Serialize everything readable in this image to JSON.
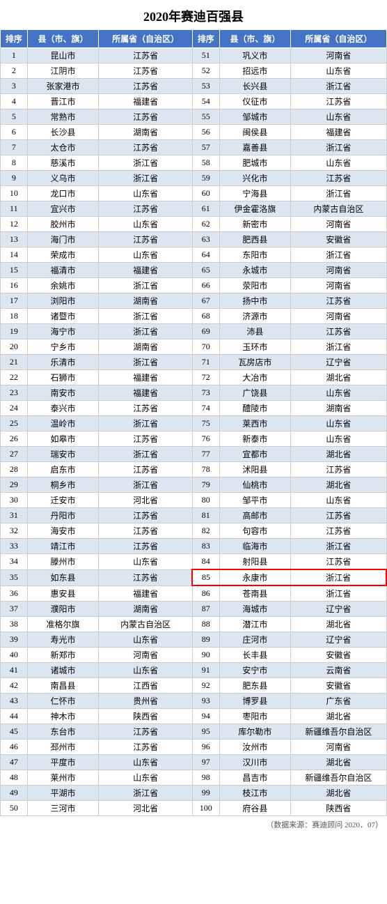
{
  "title": "2020年赛迪百强县",
  "footer": "（数据来源：赛迪顾问  2020．07）",
  "headers": [
    "排序",
    "县（市、旗）",
    "所属省（自治区）",
    "排序",
    "县（市、旗）",
    "所属省（自治区）"
  ],
  "rows": [
    {
      "left": {
        "rank": "1",
        "county": "昆山市",
        "province": "江苏省"
      },
      "right": {
        "rank": "51",
        "county": "巩义市",
        "province": "河南省"
      }
    },
    {
      "left": {
        "rank": "2",
        "county": "江阴市",
        "province": "江苏省"
      },
      "right": {
        "rank": "52",
        "county": "招远市",
        "province": "山东省"
      }
    },
    {
      "left": {
        "rank": "3",
        "county": "张家港市",
        "province": "江苏省"
      },
      "right": {
        "rank": "53",
        "county": "长兴县",
        "province": "浙江省"
      }
    },
    {
      "left": {
        "rank": "4",
        "county": "晋江市",
        "province": "福建省"
      },
      "right": {
        "rank": "54",
        "county": "仪征市",
        "province": "江苏省"
      }
    },
    {
      "left": {
        "rank": "5",
        "county": "常熟市",
        "province": "江苏省"
      },
      "right": {
        "rank": "55",
        "county": "邹城市",
        "province": "山东省"
      }
    },
    {
      "left": {
        "rank": "6",
        "county": "长沙县",
        "province": "湖南省"
      },
      "right": {
        "rank": "56",
        "county": "闽侯县",
        "province": "福建省"
      }
    },
    {
      "left": {
        "rank": "7",
        "county": "太仓市",
        "province": "江苏省"
      },
      "right": {
        "rank": "57",
        "county": "嘉善县",
        "province": "浙江省"
      }
    },
    {
      "left": {
        "rank": "8",
        "county": "慈溪市",
        "province": "浙江省"
      },
      "right": {
        "rank": "58",
        "county": "肥城市",
        "province": "山东省"
      }
    },
    {
      "left": {
        "rank": "9",
        "county": "义乌市",
        "province": "浙江省"
      },
      "right": {
        "rank": "59",
        "county": "兴化市",
        "province": "江苏省"
      }
    },
    {
      "left": {
        "rank": "10",
        "county": "龙口市",
        "province": "山东省"
      },
      "right": {
        "rank": "60",
        "county": "宁海县",
        "province": "浙江省"
      }
    },
    {
      "left": {
        "rank": "11",
        "county": "宜兴市",
        "province": "江苏省"
      },
      "right": {
        "rank": "61",
        "county": "伊金霍洛旗",
        "province": "内蒙古自治区"
      }
    },
    {
      "left": {
        "rank": "12",
        "county": "胶州市",
        "province": "山东省"
      },
      "right": {
        "rank": "62",
        "county": "新密市",
        "province": "河南省"
      }
    },
    {
      "left": {
        "rank": "13",
        "county": "海门市",
        "province": "江苏省"
      },
      "right": {
        "rank": "63",
        "county": "肥西县",
        "province": "安徽省"
      }
    },
    {
      "left": {
        "rank": "14",
        "county": "荣成市",
        "province": "山东省"
      },
      "right": {
        "rank": "64",
        "county": "东阳市",
        "province": "浙江省"
      }
    },
    {
      "left": {
        "rank": "15",
        "county": "福清市",
        "province": "福建省"
      },
      "right": {
        "rank": "65",
        "county": "永城市",
        "province": "河南省"
      }
    },
    {
      "left": {
        "rank": "16",
        "county": "余姚市",
        "province": "浙江省"
      },
      "right": {
        "rank": "66",
        "county": "荥阳市",
        "province": "河南省"
      }
    },
    {
      "left": {
        "rank": "17",
        "county": "浏阳市",
        "province": "湖南省"
      },
      "right": {
        "rank": "67",
        "county": "扬中市",
        "province": "江苏省"
      }
    },
    {
      "left": {
        "rank": "18",
        "county": "诸暨市",
        "province": "浙江省"
      },
      "right": {
        "rank": "68",
        "county": "济源市",
        "province": "河南省"
      }
    },
    {
      "left": {
        "rank": "19",
        "county": "海宁市",
        "province": "浙江省"
      },
      "right": {
        "rank": "69",
        "county": "沛县",
        "province": "江苏省"
      }
    },
    {
      "left": {
        "rank": "20",
        "county": "宁乡市",
        "province": "湖南省"
      },
      "right": {
        "rank": "70",
        "county": "玉环市",
        "province": "浙江省"
      }
    },
    {
      "left": {
        "rank": "21",
        "county": "乐清市",
        "province": "浙江省"
      },
      "right": {
        "rank": "71",
        "county": "瓦房店市",
        "province": "辽宁省"
      }
    },
    {
      "left": {
        "rank": "22",
        "county": "石狮市",
        "province": "福建省"
      },
      "right": {
        "rank": "72",
        "county": "大冶市",
        "province": "湖北省"
      }
    },
    {
      "left": {
        "rank": "23",
        "county": "南安市",
        "province": "福建省"
      },
      "right": {
        "rank": "73",
        "county": "广饶县",
        "province": "山东省"
      }
    },
    {
      "left": {
        "rank": "24",
        "county": "泰兴市",
        "province": "江苏省"
      },
      "right": {
        "rank": "74",
        "county": "醴陵市",
        "province": "湖南省"
      }
    },
    {
      "left": {
        "rank": "25",
        "county": "温岭市",
        "province": "浙江省"
      },
      "right": {
        "rank": "75",
        "county": "莱西市",
        "province": "山东省"
      }
    },
    {
      "left": {
        "rank": "26",
        "county": "如皋市",
        "province": "江苏省"
      },
      "right": {
        "rank": "76",
        "county": "新泰市",
        "province": "山东省"
      }
    },
    {
      "left": {
        "rank": "27",
        "county": "瑞安市",
        "province": "浙江省"
      },
      "right": {
        "rank": "77",
        "county": "宜都市",
        "province": "湖北省"
      }
    },
    {
      "left": {
        "rank": "28",
        "county": "启东市",
        "province": "江苏省"
      },
      "right": {
        "rank": "78",
        "county": "沭阳县",
        "province": "江苏省"
      }
    },
    {
      "left": {
        "rank": "29",
        "county": "桐乡市",
        "province": "浙江省"
      },
      "right": {
        "rank": "79",
        "county": "仙桃市",
        "province": "湖北省"
      }
    },
    {
      "left": {
        "rank": "30",
        "county": "迁安市",
        "province": "河北省"
      },
      "right": {
        "rank": "80",
        "county": "邹平市",
        "province": "山东省"
      }
    },
    {
      "left": {
        "rank": "31",
        "county": "丹阳市",
        "province": "江苏省"
      },
      "right": {
        "rank": "81",
        "county": "高邮市",
        "province": "江苏省"
      }
    },
    {
      "left": {
        "rank": "32",
        "county": "海安市",
        "province": "江苏省"
      },
      "right": {
        "rank": "82",
        "county": "句容市",
        "province": "江苏省"
      }
    },
    {
      "left": {
        "rank": "33",
        "county": "靖江市",
        "province": "江苏省"
      },
      "right": {
        "rank": "83",
        "county": "临海市",
        "province": "浙江省"
      }
    },
    {
      "left": {
        "rank": "34",
        "county": "滕州市",
        "province": "山东省"
      },
      "right": {
        "rank": "84",
        "county": "射阳县",
        "province": "江苏省"
      }
    },
    {
      "left": {
        "rank": "35",
        "county": "如东县",
        "province": "江苏省"
      },
      "right": {
        "rank": "85",
        "county": "永康市",
        "province": "浙江省"
      },
      "highlight": true
    },
    {
      "left": {
        "rank": "36",
        "county": "惠安县",
        "province": "福建省"
      },
      "right": {
        "rank": "86",
        "county": "苍南县",
        "province": "浙江省"
      }
    },
    {
      "left": {
        "rank": "37",
        "county": "濮阳市",
        "province": "湖南省"
      },
      "right": {
        "rank": "87",
        "county": "海城市",
        "province": "辽宁省"
      }
    },
    {
      "left": {
        "rank": "38",
        "county": "准格尔旗",
        "province": "内蒙古自治区"
      },
      "right": {
        "rank": "88",
        "county": "潜江市",
        "province": "湖北省"
      }
    },
    {
      "left": {
        "rank": "39",
        "county": "寿光市",
        "province": "山东省"
      },
      "right": {
        "rank": "89",
        "county": "庄河市",
        "province": "辽宁省"
      }
    },
    {
      "left": {
        "rank": "40",
        "county": "新郑市",
        "province": "河南省"
      },
      "right": {
        "rank": "90",
        "county": "长丰县",
        "province": "安徽省"
      }
    },
    {
      "left": {
        "rank": "41",
        "county": "诸城市",
        "province": "山东省"
      },
      "right": {
        "rank": "91",
        "county": "安宁市",
        "province": "云南省"
      }
    },
    {
      "left": {
        "rank": "42",
        "county": "南昌县",
        "province": "江西省"
      },
      "right": {
        "rank": "92",
        "county": "肥东县",
        "province": "安徽省"
      }
    },
    {
      "left": {
        "rank": "43",
        "county": "仁怀市",
        "province": "贵州省"
      },
      "right": {
        "rank": "93",
        "county": "博罗县",
        "province": "广东省"
      }
    },
    {
      "left": {
        "rank": "44",
        "county": "神木市",
        "province": "陕西省"
      },
      "right": {
        "rank": "94",
        "county": "枣阳市",
        "province": "湖北省"
      }
    },
    {
      "left": {
        "rank": "45",
        "county": "东台市",
        "province": "江苏省"
      },
      "right": {
        "rank": "95",
        "county": "库尔勒市",
        "province": "新疆维吾尔自治区"
      }
    },
    {
      "left": {
        "rank": "46",
        "county": "邳州市",
        "province": "江苏省"
      },
      "right": {
        "rank": "96",
        "county": "汝州市",
        "province": "河南省"
      }
    },
    {
      "left": {
        "rank": "47",
        "county": "平度市",
        "province": "山东省"
      },
      "right": {
        "rank": "97",
        "county": "汉川市",
        "province": "湖北省"
      }
    },
    {
      "left": {
        "rank": "48",
        "county": "莱州市",
        "province": "山东省"
      },
      "right": {
        "rank": "98",
        "county": "昌吉市",
        "province": "新疆维吾尔自治区"
      }
    },
    {
      "left": {
        "rank": "49",
        "county": "平湖市",
        "province": "浙江省"
      },
      "right": {
        "rank": "99",
        "county": "枝江市",
        "province": "湖北省"
      }
    },
    {
      "left": {
        "rank": "50",
        "county": "三河市",
        "province": "河北省"
      },
      "right": {
        "rank": "100",
        "county": "府谷县",
        "province": "陕西省"
      }
    }
  ]
}
